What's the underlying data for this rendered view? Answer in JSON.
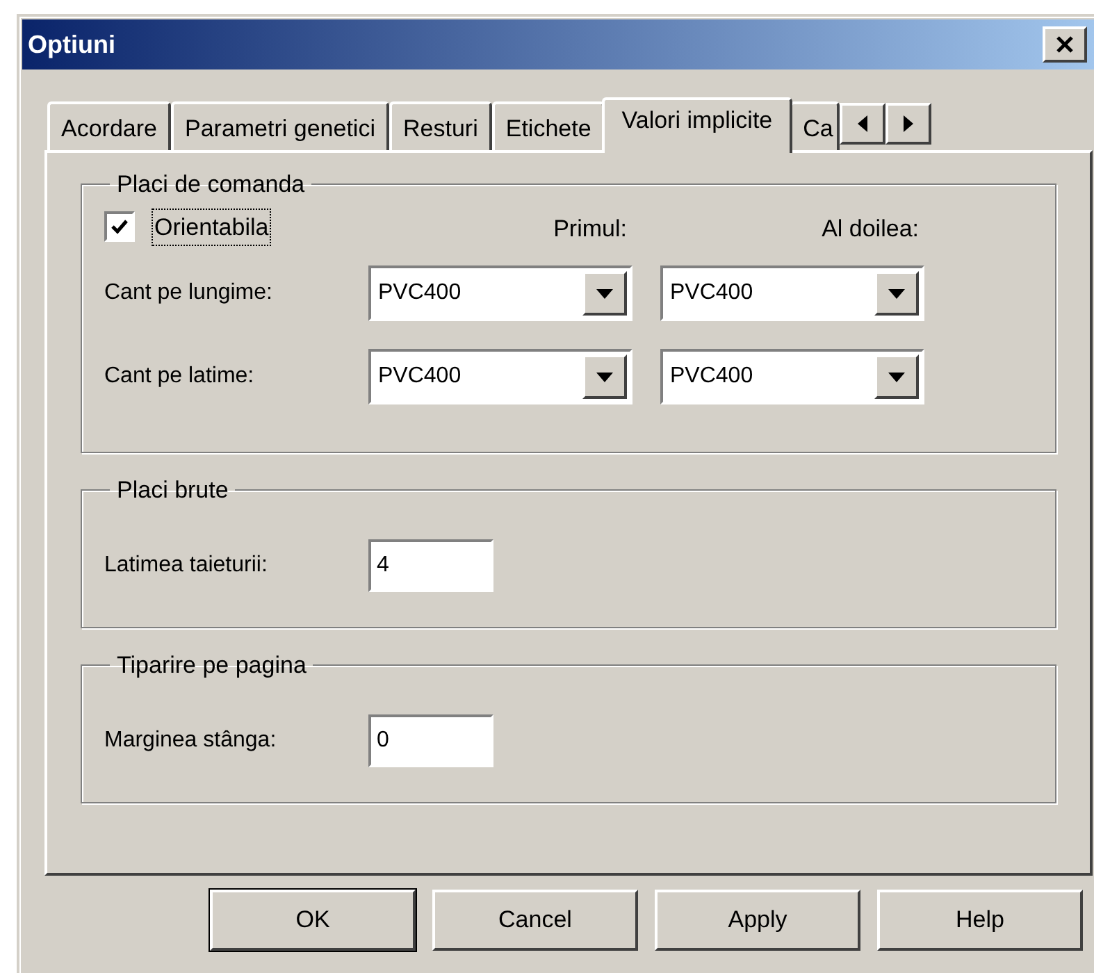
{
  "window": {
    "title": "Optiuni"
  },
  "tabs": [
    {
      "label": "Acordare",
      "selected": false
    },
    {
      "label": "Parametri genetici",
      "selected": false
    },
    {
      "label": "Resturi",
      "selected": false
    },
    {
      "label": "Etichete",
      "selected": false
    },
    {
      "label": "Valori implicite",
      "selected": true
    },
    {
      "label": "Ca",
      "selected": false
    }
  ],
  "placi_de_comanda": {
    "title": "Placi de comanda",
    "orientabila": {
      "label": "Orientabila",
      "checked": true
    },
    "column_headers": [
      "Primul:",
      "Al doilea:"
    ],
    "rows": [
      {
        "label": "Cant pe lungime:",
        "values": [
          "PVC400",
          "PVC400"
        ]
      },
      {
        "label": "Cant pe latime:",
        "values": [
          "PVC400",
          "PVC400"
        ]
      }
    ]
  },
  "placi_brute": {
    "title": "Placi brute",
    "field": {
      "label": "Latimea taieturii:",
      "value": "4"
    }
  },
  "tiparire_pe_pagina": {
    "title": "Tiparire pe pagina",
    "field": {
      "label": "Marginea stânga:",
      "value": "0"
    }
  },
  "buttons": [
    {
      "label": "OK",
      "default": true
    },
    {
      "label": "Cancel",
      "default": false
    },
    {
      "label": "Apply",
      "default": false
    },
    {
      "label": "Help",
      "default": false
    }
  ]
}
